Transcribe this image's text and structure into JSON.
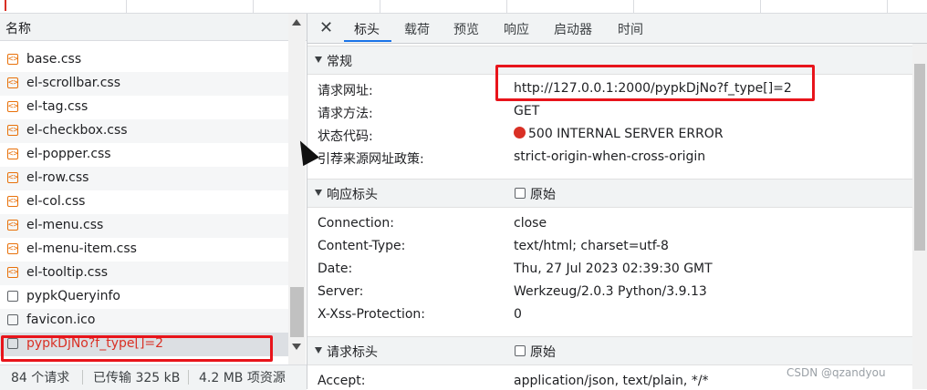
{
  "network_list": {
    "header_title": "名称",
    "requests": [
      {
        "name": "base.css",
        "icon": "css-file-icon"
      },
      {
        "name": "el-scrollbar.css",
        "icon": "css-file-icon"
      },
      {
        "name": "el-tag.css",
        "icon": "css-file-icon"
      },
      {
        "name": "el-checkbox.css",
        "icon": "css-file-icon"
      },
      {
        "name": "el-popper.css",
        "icon": "css-file-icon"
      },
      {
        "name": "el-row.css",
        "icon": "css-file-icon"
      },
      {
        "name": "el-col.css",
        "icon": "css-file-icon"
      },
      {
        "name": "el-menu.css",
        "icon": "css-file-icon"
      },
      {
        "name": "el-menu-item.css",
        "icon": "css-file-icon"
      },
      {
        "name": "el-tooltip.css",
        "icon": "css-file-icon"
      },
      {
        "name": "pypkQueryinfo",
        "icon": "document-icon"
      },
      {
        "name": "favicon.ico",
        "icon": "document-icon"
      },
      {
        "name": "pypkDjNo?f_type[]=2",
        "icon": "document-icon",
        "selected": true
      }
    ]
  },
  "status_bar": {
    "requests": "84 个请求",
    "transferred": "已传输 325 kB",
    "resources": "4.2 MB 项资源"
  },
  "detail": {
    "tabs": [
      "标头",
      "载荷",
      "预览",
      "响应",
      "启动器",
      "时间"
    ],
    "active_tab": "标头",
    "general": {
      "title": "常规",
      "rows": [
        {
          "key": "请求网址:",
          "value": "http://127.0.0.1:2000/pypkDjNo?f_type[]=2"
        },
        {
          "key": "请求方法:",
          "value": "GET"
        },
        {
          "key": "状态代码:",
          "value": "500 INTERNAL SERVER ERROR"
        },
        {
          "key": "引荐来源网址政策:",
          "value": "strict-origin-when-cross-origin"
        }
      ]
    },
    "response_headers": {
      "title": "响应标头",
      "raw_label": "原始",
      "rows": [
        {
          "key": "Connection:",
          "value": "close"
        },
        {
          "key": "Content-Type:",
          "value": "text/html; charset=utf-8"
        },
        {
          "key": "Date:",
          "value": "Thu, 27 Jul 2023 02:39:30 GMT"
        },
        {
          "key": "Server:",
          "value": "Werkzeug/2.0.3 Python/3.9.13"
        },
        {
          "key": "X-Xss-Protection:",
          "value": "0"
        }
      ]
    },
    "request_headers": {
      "title": "请求标头",
      "raw_label": "原始",
      "rows": [
        {
          "key": "Accept:",
          "value": "application/json, text/plain, */*"
        }
      ]
    }
  },
  "watermark": "CSDN @qzandyou",
  "colors": {
    "error": "#d93025",
    "highlight_box": "#e8141b",
    "tab_accent": "#1a73e8"
  }
}
